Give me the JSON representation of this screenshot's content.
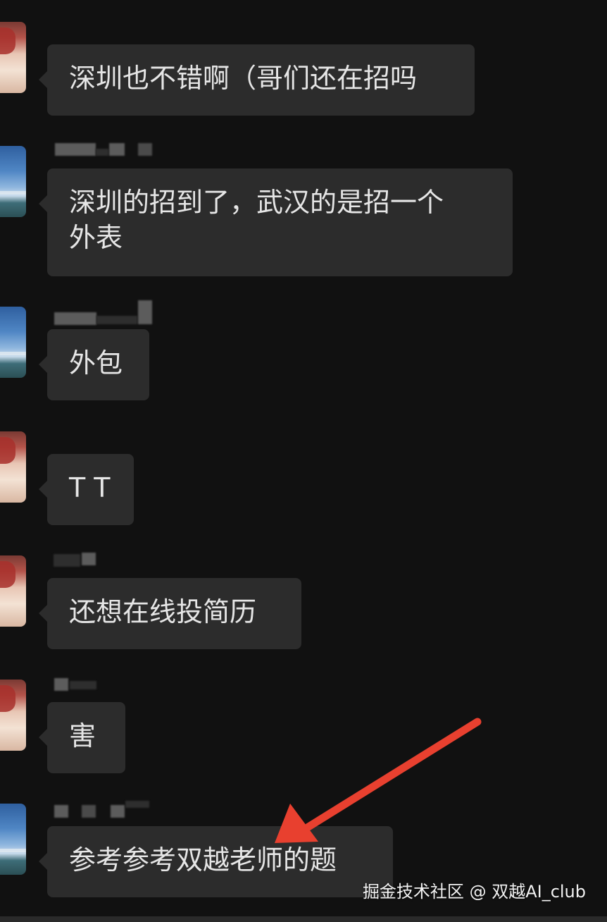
{
  "messages": [
    {
      "sender": "girl",
      "text": "深圳也不错啊（哥们还在招吗"
    },
    {
      "sender": "sky",
      "text": "深圳的招到了，武汉的是招一个\n外表"
    },
    {
      "sender": "sky",
      "text": "外包"
    },
    {
      "sender": "girl",
      "text": "T T"
    },
    {
      "sender": "girl",
      "text": "还想在线投简历"
    },
    {
      "sender": "girl",
      "text": "害"
    },
    {
      "sender": "sky",
      "text": "参考参考双越老师的题"
    }
  ],
  "watermark": "掘金技术社区 @ 双越AI_club",
  "colors": {
    "background": "#111111",
    "bubble": "#2c2c2c",
    "text": "#e6e6e6",
    "arrow": "#e8402f"
  },
  "icons": {
    "girl_avatar": "avatar-girl-red-hat",
    "sky_avatar": "avatar-sky-sea"
  }
}
